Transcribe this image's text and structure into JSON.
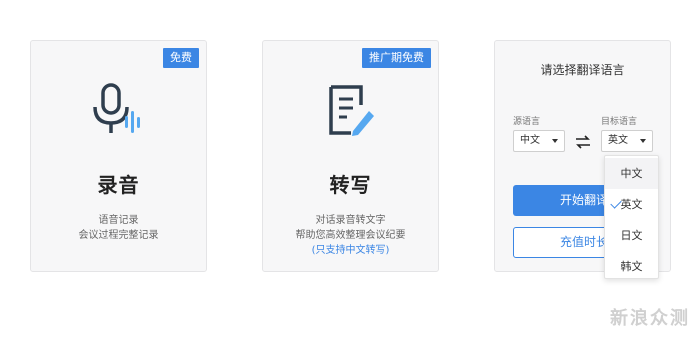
{
  "cards": [
    {
      "badge": "免费",
      "icon": "microphone-icon",
      "title": "录音",
      "desc": [
        "语音记录",
        "会议过程完整记录"
      ]
    },
    {
      "badge": "推广期免费",
      "icon": "document-edit-icon",
      "title": "转写",
      "desc": [
        "对话录音转文字",
        "帮助您高效整理会议纪要"
      ],
      "link": "(只支持中文转写)"
    }
  ],
  "translate_panel": {
    "title": "请选择翻译语言",
    "source_label": "源语言",
    "target_label": "目标语言",
    "source_value": "中文",
    "target_value": "英文",
    "swap_icon": "swap-arrows-icon",
    "start_button": "开始翻译",
    "recharge_button": "充值时长"
  },
  "dropdown": {
    "options": [
      "中文",
      "英文",
      "日文",
      "韩文"
    ],
    "selected": "英文",
    "hovered": "中文"
  },
  "watermark": "新浪众测",
  "colors": {
    "accent": "#3b86e4",
    "card_bg": "#f7f7f8"
  }
}
